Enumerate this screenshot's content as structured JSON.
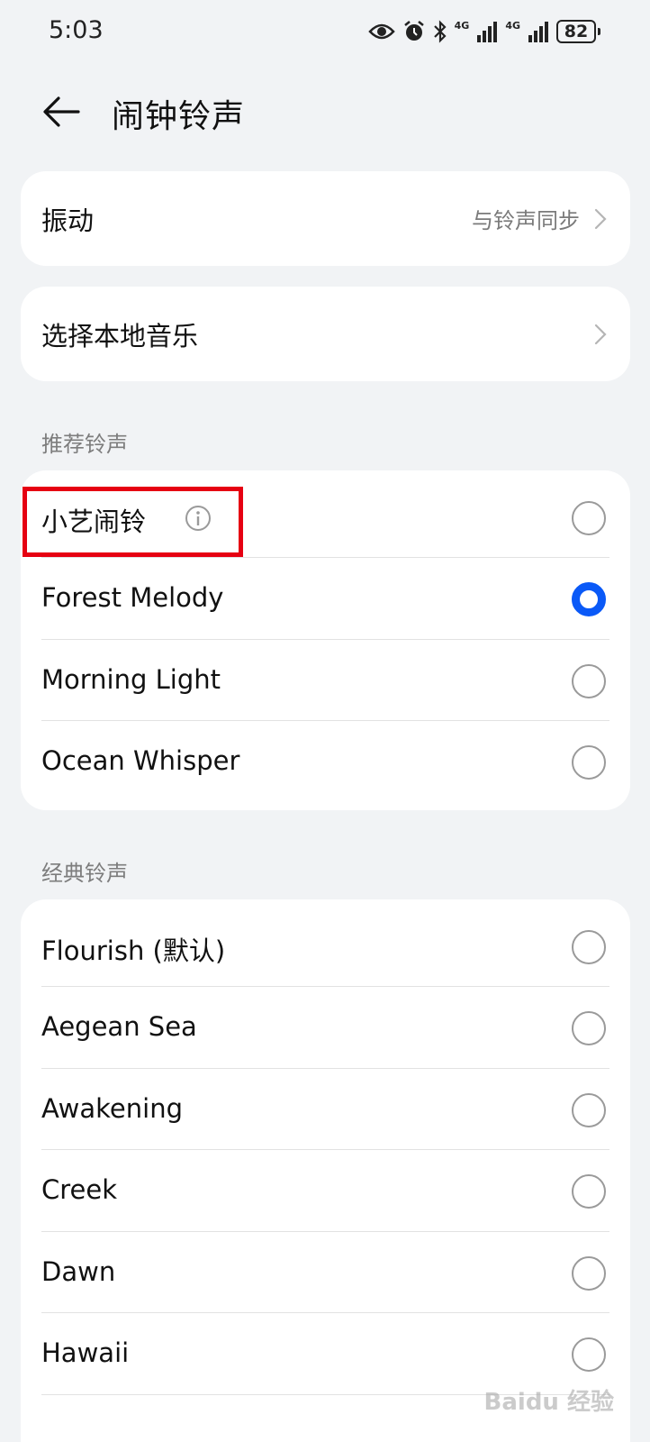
{
  "status_bar": {
    "time": "5:03",
    "network1": "4G",
    "network2": "4G",
    "battery": "82",
    "icons": [
      "eye-icon",
      "alarm-icon",
      "bluetooth-icon",
      "signal-icon",
      "signal-icon",
      "battery-icon"
    ]
  },
  "header": {
    "title": "闹钟铃声",
    "back_icon": "back-arrow-icon"
  },
  "vibration": {
    "label": "振动",
    "value": "与铃声同步"
  },
  "local_music": {
    "label": "选择本地音乐"
  },
  "recommended": {
    "title": "推荐铃声",
    "items": [
      {
        "label": "小艺闹铃",
        "checked": false
      },
      {
        "label": "Forest Melody",
        "checked": true
      },
      {
        "label": "Morning Light",
        "checked": false
      },
      {
        "label": "Ocean Whisper",
        "checked": false
      }
    ]
  },
  "classic": {
    "title": "经典铃声",
    "items": [
      {
        "label": "Flourish (默认)",
        "checked": false
      },
      {
        "label": "Aegean Sea",
        "checked": false
      },
      {
        "label": "Awakening",
        "checked": false
      },
      {
        "label": "Creek",
        "checked": false
      },
      {
        "label": "Dawn",
        "checked": false
      },
      {
        "label": "Hawaii",
        "checked": false
      }
    ]
  },
  "watermark": "Baidu 经验",
  "colors": {
    "background": "#f1f3f5",
    "card": "#ffffff",
    "accent": "#0a59f7",
    "highlight": "#e60012"
  }
}
